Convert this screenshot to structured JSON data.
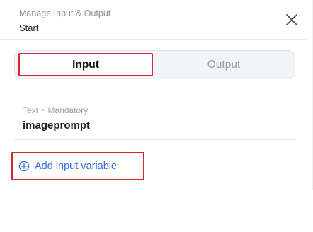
{
  "header": {
    "subtitle": "Manage Input & Output",
    "title": "Start",
    "close_icon": "close-icon"
  },
  "tabs": [
    {
      "label": "Input",
      "selected": true
    },
    {
      "label": "Output",
      "selected": false
    }
  ],
  "variables": [
    {
      "type": "Text",
      "requirement": "Mandatory",
      "name": "imageprompt"
    }
  ],
  "add_variable": {
    "label": "Add input variable",
    "icon": "plus-circle-icon"
  },
  "colors": {
    "accent_blue": "#2f6fdb",
    "highlight_red": "#d7262e",
    "muted_text": "#9aa0a8"
  }
}
